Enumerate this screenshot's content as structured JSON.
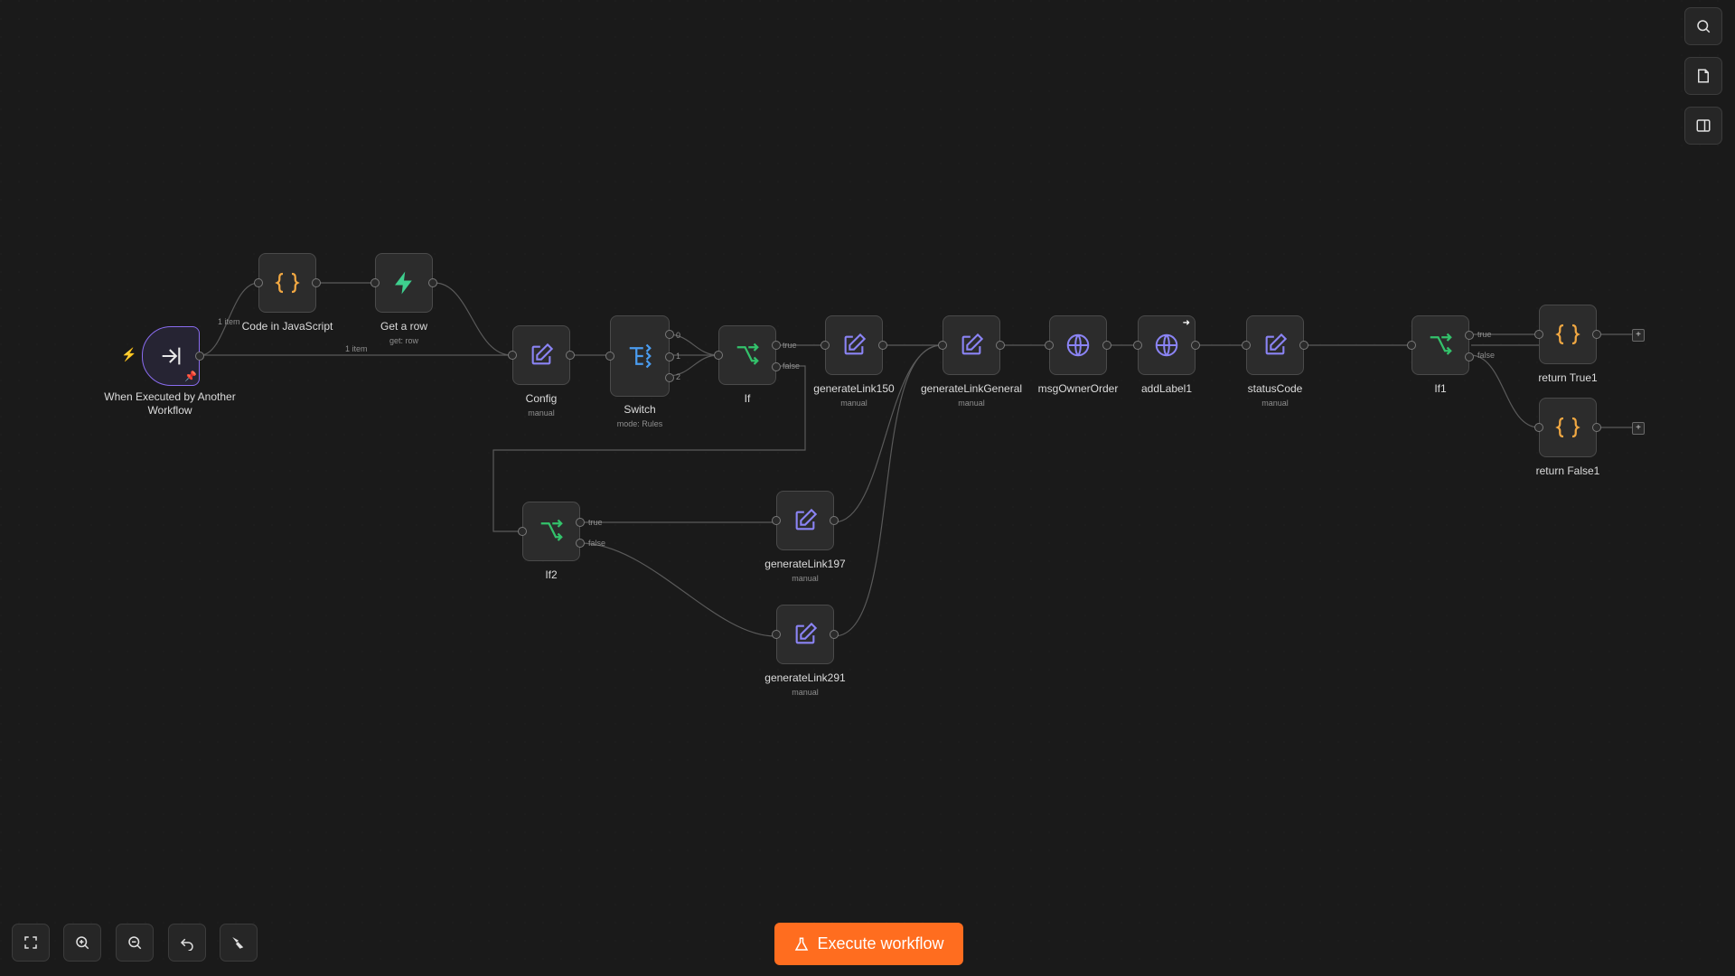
{
  "nodes": {
    "trigger": {
      "label": "When Executed by Another Workflow"
    },
    "code_js": {
      "label": "Code in JavaScript"
    },
    "get_row": {
      "label": "Get a row",
      "sub": "get: row"
    },
    "config": {
      "label": "Config",
      "sub": "manual"
    },
    "switch": {
      "label": "Switch",
      "sub": "mode: Rules",
      "outputs": [
        "0",
        "1",
        "2"
      ]
    },
    "if": {
      "label": "If"
    },
    "gen150": {
      "label": "generateLink150",
      "sub": "manual"
    },
    "gen_general": {
      "label": "generateLinkGeneral",
      "sub": "manual"
    },
    "msg_owner": {
      "label": "msgOwnerOrder"
    },
    "add_label": {
      "label": "addLabel1"
    },
    "status_code": {
      "label": "statusCode",
      "sub": "manual"
    },
    "if1": {
      "label": "If1"
    },
    "ret_true": {
      "label": "return True1"
    },
    "ret_false": {
      "label": "return False1"
    },
    "if2": {
      "label": "If2"
    },
    "gen197": {
      "label": "generateLink197",
      "sub": "manual"
    },
    "gen291": {
      "label": "generateLink291",
      "sub": "manual"
    }
  },
  "edges": {
    "items_1": "1 item",
    "items_2": "1 item",
    "true": "true",
    "false": "false"
  },
  "toolbar": {
    "execute_label": "Execute workflow"
  },
  "colors": {
    "accent": "#ff6d1f",
    "code": "#f0a742",
    "supabase": "#3ecf8e",
    "edit": "#8b84f5",
    "if": "#33c26b",
    "switch": "#4a9cf0"
  }
}
